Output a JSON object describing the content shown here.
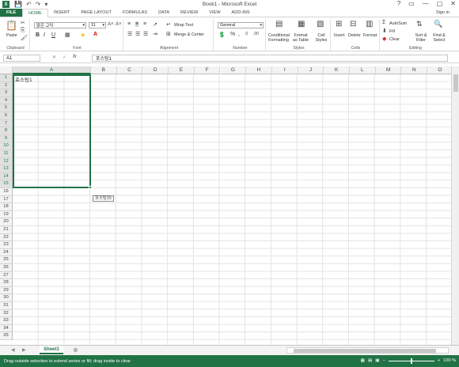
{
  "app": {
    "title": "Book1 - Microsoft Excel",
    "logo": "X",
    "signin": "Sign in",
    "window_controls": [
      "?",
      "▭",
      "—",
      "▢",
      "✕"
    ]
  },
  "tabs": [
    "FILE",
    "HOME",
    "INSERT",
    "PAGE LAYOUT",
    "FORMULAS",
    "DATA",
    "REVIEW",
    "VIEW",
    "ADD-INS"
  ],
  "active_tab": "HOME",
  "ribbon": {
    "clipboard": {
      "paste": "Paste",
      "label": "Clipboard"
    },
    "font": {
      "name": "맑은 고딕",
      "size": "11",
      "label": "Font",
      "bold": "B",
      "italic": "I",
      "underline": "U"
    },
    "alignment": {
      "wrap": "Wrap Text",
      "merge": "Merge & Center",
      "label": "Alignment"
    },
    "number": {
      "format": "General",
      "label": "Number"
    },
    "styles": {
      "conditional": "Conditional Formatting",
      "format_table": "Format as Table",
      "cell_styles": "Cell Styles",
      "label": "Styles"
    },
    "cells": {
      "insert": "Insert",
      "delete": "Delete",
      "format": "Format",
      "label": "Cells"
    },
    "editing": {
      "autosum": "AutoSum",
      "fill": "Fill",
      "clear": "Clear",
      "sort": "Sort & Filter",
      "find": "Find & Select",
      "label": "Editing"
    }
  },
  "formula_bar": {
    "name_box": "A1",
    "cancel": "✕",
    "enter": "✓",
    "fx": "fx",
    "content": "포스팅1"
  },
  "columns": [
    "A",
    "B",
    "C",
    "D",
    "E",
    "F",
    "G",
    "H",
    "I",
    "J",
    "K",
    "L",
    "M",
    "N",
    "O"
  ],
  "rows": [
    "1",
    "2",
    "3",
    "4",
    "5",
    "6",
    "7",
    "8",
    "9",
    "10",
    "11",
    "12",
    "13",
    "14",
    "15",
    "16",
    "17",
    "18",
    "19",
    "20",
    "21",
    "22",
    "23",
    "24",
    "25",
    "26",
    "27",
    "28",
    "29",
    "30",
    "31",
    "32",
    "33",
    "34",
    "35"
  ],
  "cell_a1": "포스팅1",
  "fill_tooltip": "포스팅15",
  "sheet": {
    "name": "Sheet1"
  },
  "status": {
    "message": "Drag outside selection to extend series or fill; drag inside to clear",
    "zoom": "100 %"
  },
  "colors": {
    "accent": "#217346"
  }
}
